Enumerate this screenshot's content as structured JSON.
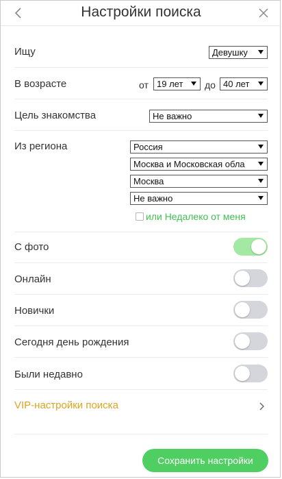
{
  "header": {
    "title": "Настройки поиска"
  },
  "filters": {
    "seeking": {
      "label": "Ищу",
      "value": "Девушку"
    },
    "age": {
      "label": "В возрасте",
      "from_label": "от",
      "from_value": "19 лет",
      "to_label": "до",
      "to_value": "40 лет"
    },
    "purpose": {
      "label": "Цель знакомства",
      "value": "Не важно"
    },
    "region": {
      "label": "Из региона",
      "country": "Россия",
      "region": "Москва и Московская обла",
      "city": "Москва",
      "district": "Не важно",
      "nearby_label": "или Недалеко от меня"
    }
  },
  "toggles": [
    {
      "label": "С фото",
      "on": true
    },
    {
      "label": "Онлайн",
      "on": false
    },
    {
      "label": "Новички",
      "on": false
    },
    {
      "label": "Сегодня день рождения",
      "on": false
    },
    {
      "label": "Были недавно",
      "on": false
    }
  ],
  "vip": {
    "label": "VIP-настройки поиска"
  },
  "actions": {
    "save_label": "Сохранить настройки"
  },
  "colors": {
    "accent_green": "#4fcf62",
    "toggle_on": "#a3e9a3",
    "toggle_off": "#d4d6dc",
    "vip_gold": "#d9a521",
    "nearby_green": "#3fbf4f"
  }
}
